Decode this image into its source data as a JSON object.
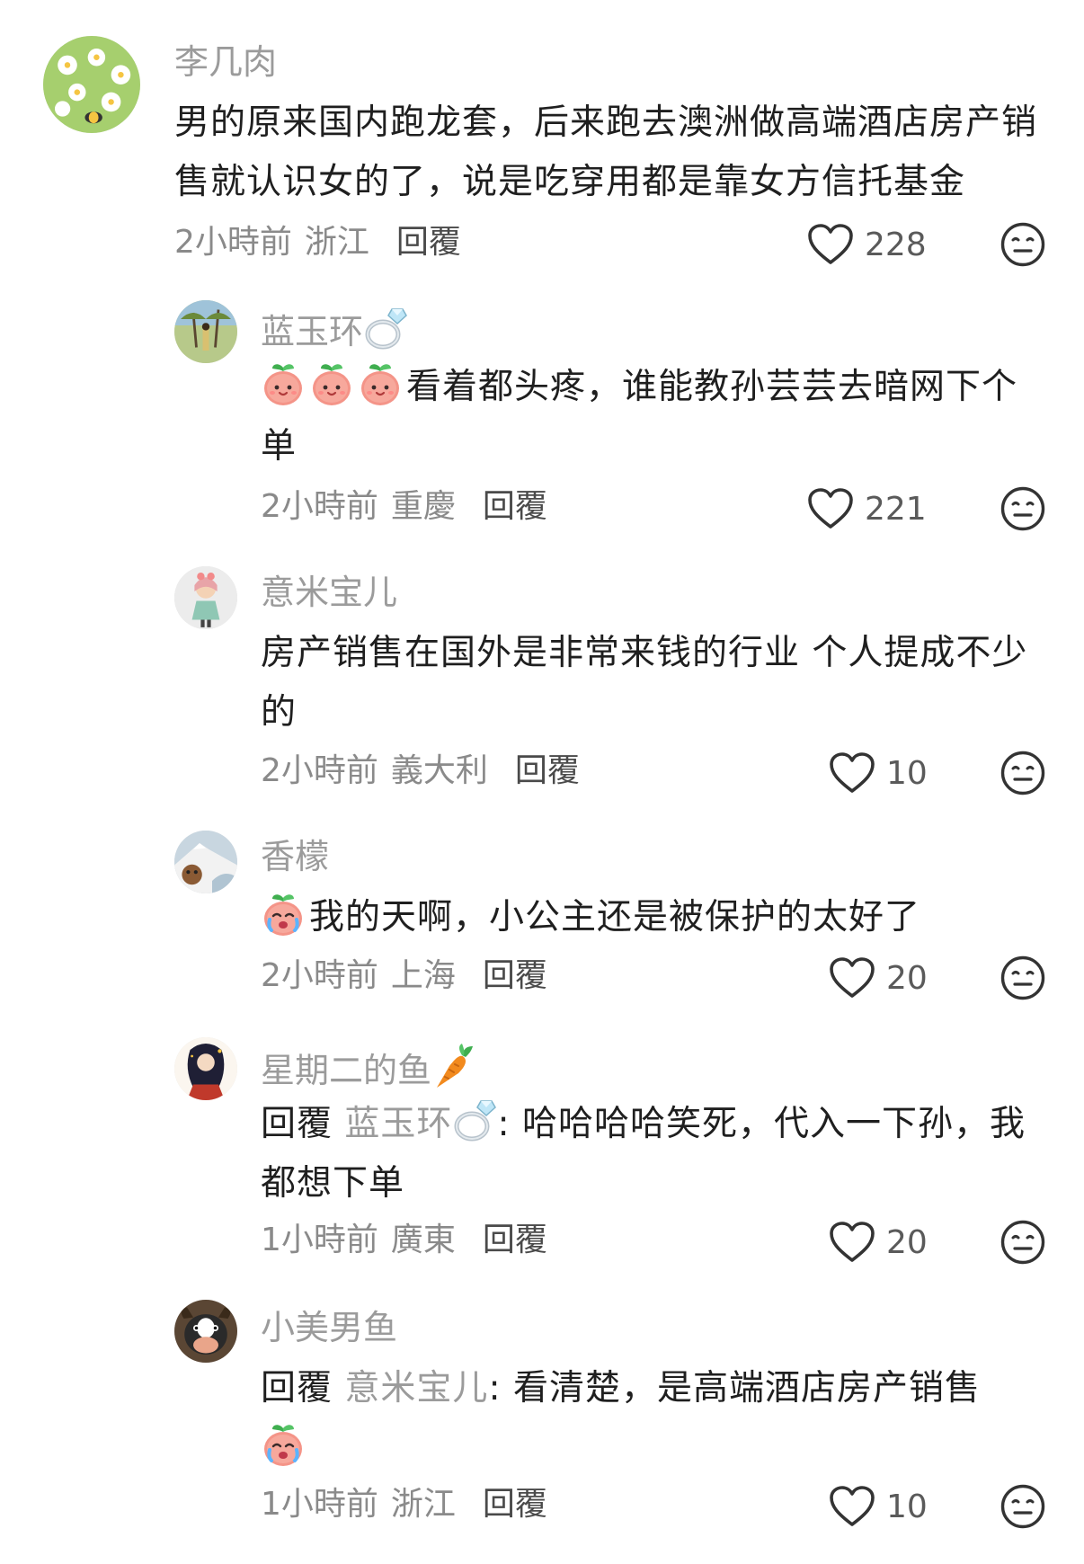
{
  "comments": [
    {
      "username": "李几肉",
      "text": "男的原来国内跑龙套，后来跑去澳洲做高端酒店房产销售就认识女的了，说是吃穿用都是靠女方信托基金",
      "time": "2小時前",
      "location": "浙江",
      "reply_label": "回覆",
      "likes": "228"
    },
    {
      "username": "蓝玉环",
      "text": "看着都头疼，谁能教孙芸芸去暗网下个单",
      "time": "2小時前",
      "location": "重慶",
      "reply_label": "回覆",
      "likes": "221"
    },
    {
      "username": "意米宝儿",
      "text": "房产销售在国外是非常来钱的行业 个人提成不少的",
      "time": "2小時前",
      "location": "義大利",
      "reply_label": "回覆",
      "likes": "10"
    },
    {
      "username": "香檬",
      "text": "我的天啊，小公主还是被保护的太好了",
      "time": "2小時前",
      "location": "上海",
      "reply_label": "回覆",
      "likes": "20"
    },
    {
      "username": "星期二的鱼",
      "reply_prefix": "回覆",
      "reply_to": "蓝玉环",
      "text": ": 哈哈哈哈笑死，代入一下孙，我都想下单",
      "time": "1小時前",
      "location": "廣東",
      "reply_label": "回覆",
      "likes": "20"
    },
    {
      "username": "小美男鱼",
      "reply_prefix": "回覆",
      "reply_to": "意米宝儿",
      "text": ": 看清楚，是高端酒店房产销售",
      "time": "1小時前",
      "location": "浙江",
      "reply_label": "回覆",
      "likes": "10"
    }
  ],
  "icons": {
    "like": "heart-outline-icon",
    "dislike": "meh-face-icon",
    "emoji": "peach-smile-emoji",
    "cry_emoji": "peach-cry-emoji",
    "ring": "diamond-ring-emoji",
    "carrot": "carrot-emoji"
  }
}
